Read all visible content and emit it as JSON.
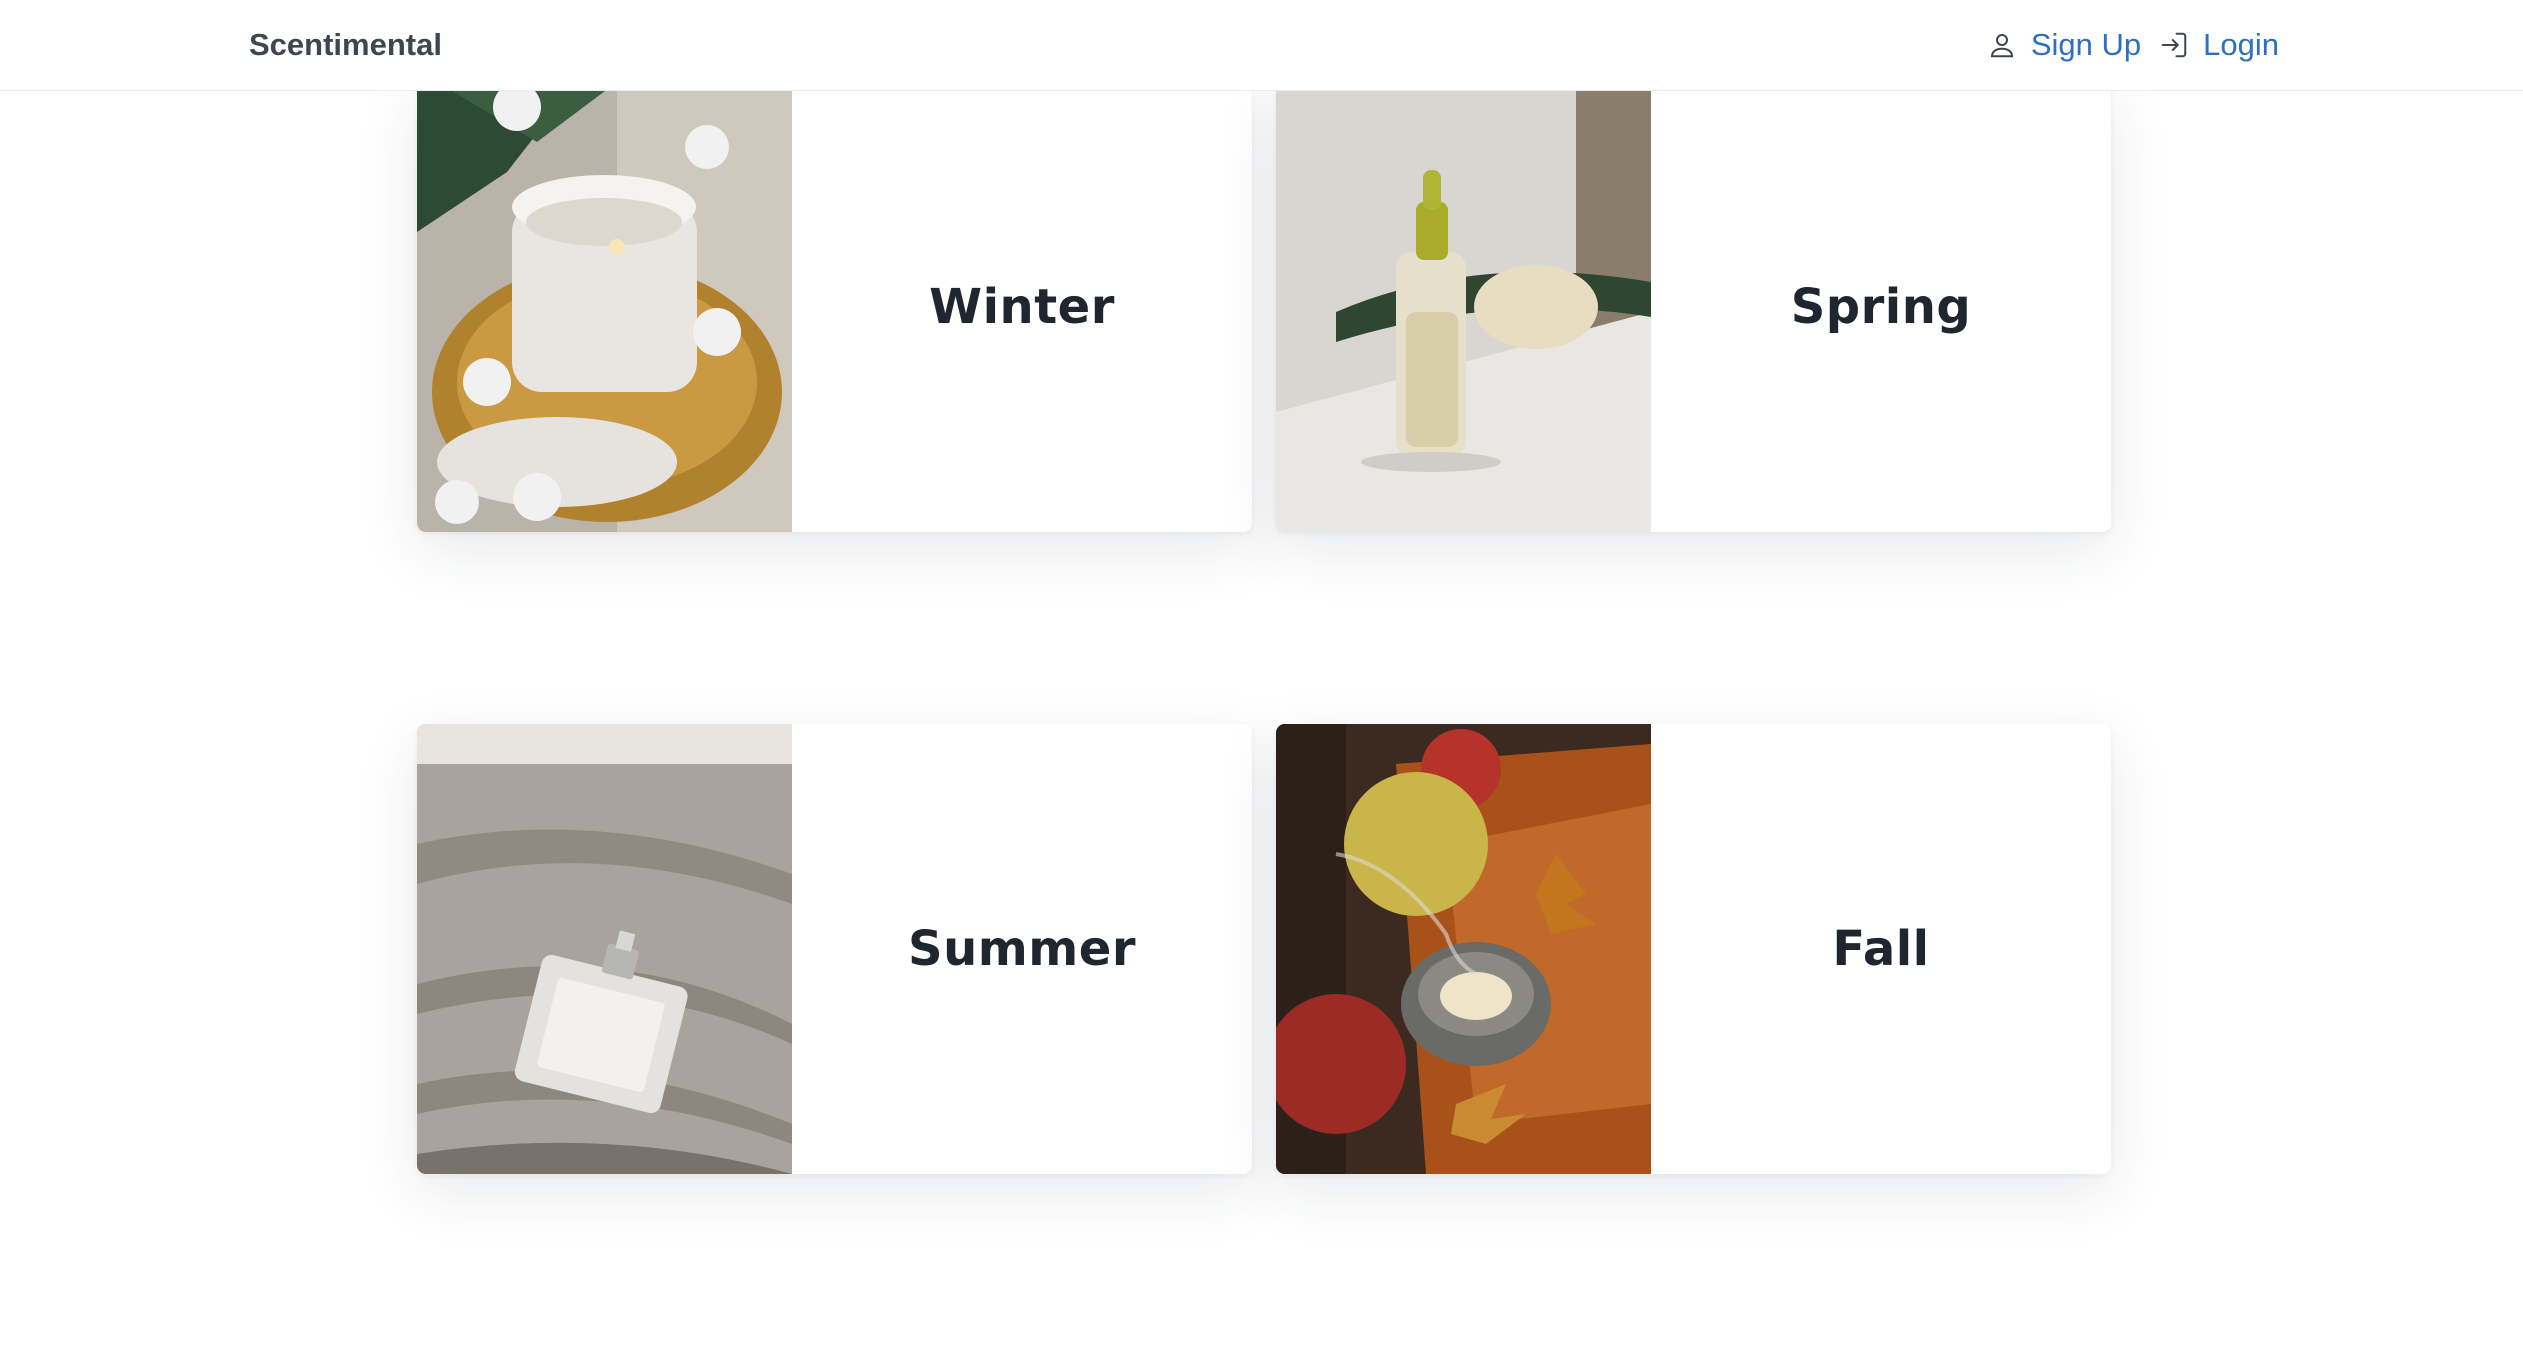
{
  "navbar": {
    "brand": "Scentimental",
    "links": [
      {
        "label": "Sign Up",
        "icon": "user-icon"
      },
      {
        "label": "Login",
        "icon": "login-icon"
      }
    ],
    "link_color": "#2d6fc0"
  },
  "cards": [
    {
      "title": "Winter",
      "image": "candle-in-snow-photo"
    },
    {
      "title": "Spring",
      "image": "dropper-bottle-photo"
    },
    {
      "title": "Summer",
      "image": "perfume-on-sand-photo"
    },
    {
      "title": "Fall",
      "image": "candle-with-apples-photo"
    }
  ]
}
